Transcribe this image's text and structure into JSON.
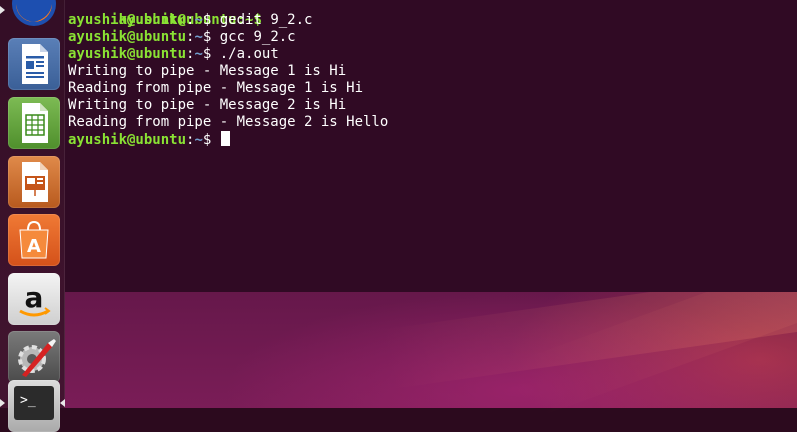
{
  "terminal": {
    "prompt": {
      "user_host": "ayushik@ubuntu",
      "sep": ":",
      "path": "~",
      "symbol": "$ "
    },
    "partial_top_line": "ayushik@ubuntu:~$",
    "commands": [
      "gedit 9_2.c",
      "gcc 9_2.c",
      "./a.out"
    ],
    "output": [
      "Writing to pipe - Message 1 is Hi",
      "Reading from pipe - Message 1 is Hi",
      "Writing to pipe - Message 2 is Hi",
      "Reading from pipe - Message 2 is Hello"
    ],
    "colors": {
      "background": "#300a24",
      "user": "#8ae234",
      "path": "#729fcf",
      "text": "#ffffff"
    }
  },
  "launcher": {
    "items": [
      {
        "name": "firefox-icon"
      },
      {
        "name": "libreoffice-writer-icon"
      },
      {
        "name": "libreoffice-calc-icon"
      },
      {
        "name": "libreoffice-impress-icon"
      },
      {
        "name": "ubuntu-software-icon",
        "glyph": "A"
      },
      {
        "name": "amazon-icon",
        "glyph": "a"
      },
      {
        "name": "system-settings-icon"
      },
      {
        "name": "terminal-icon",
        "glyph": ">_"
      }
    ]
  }
}
